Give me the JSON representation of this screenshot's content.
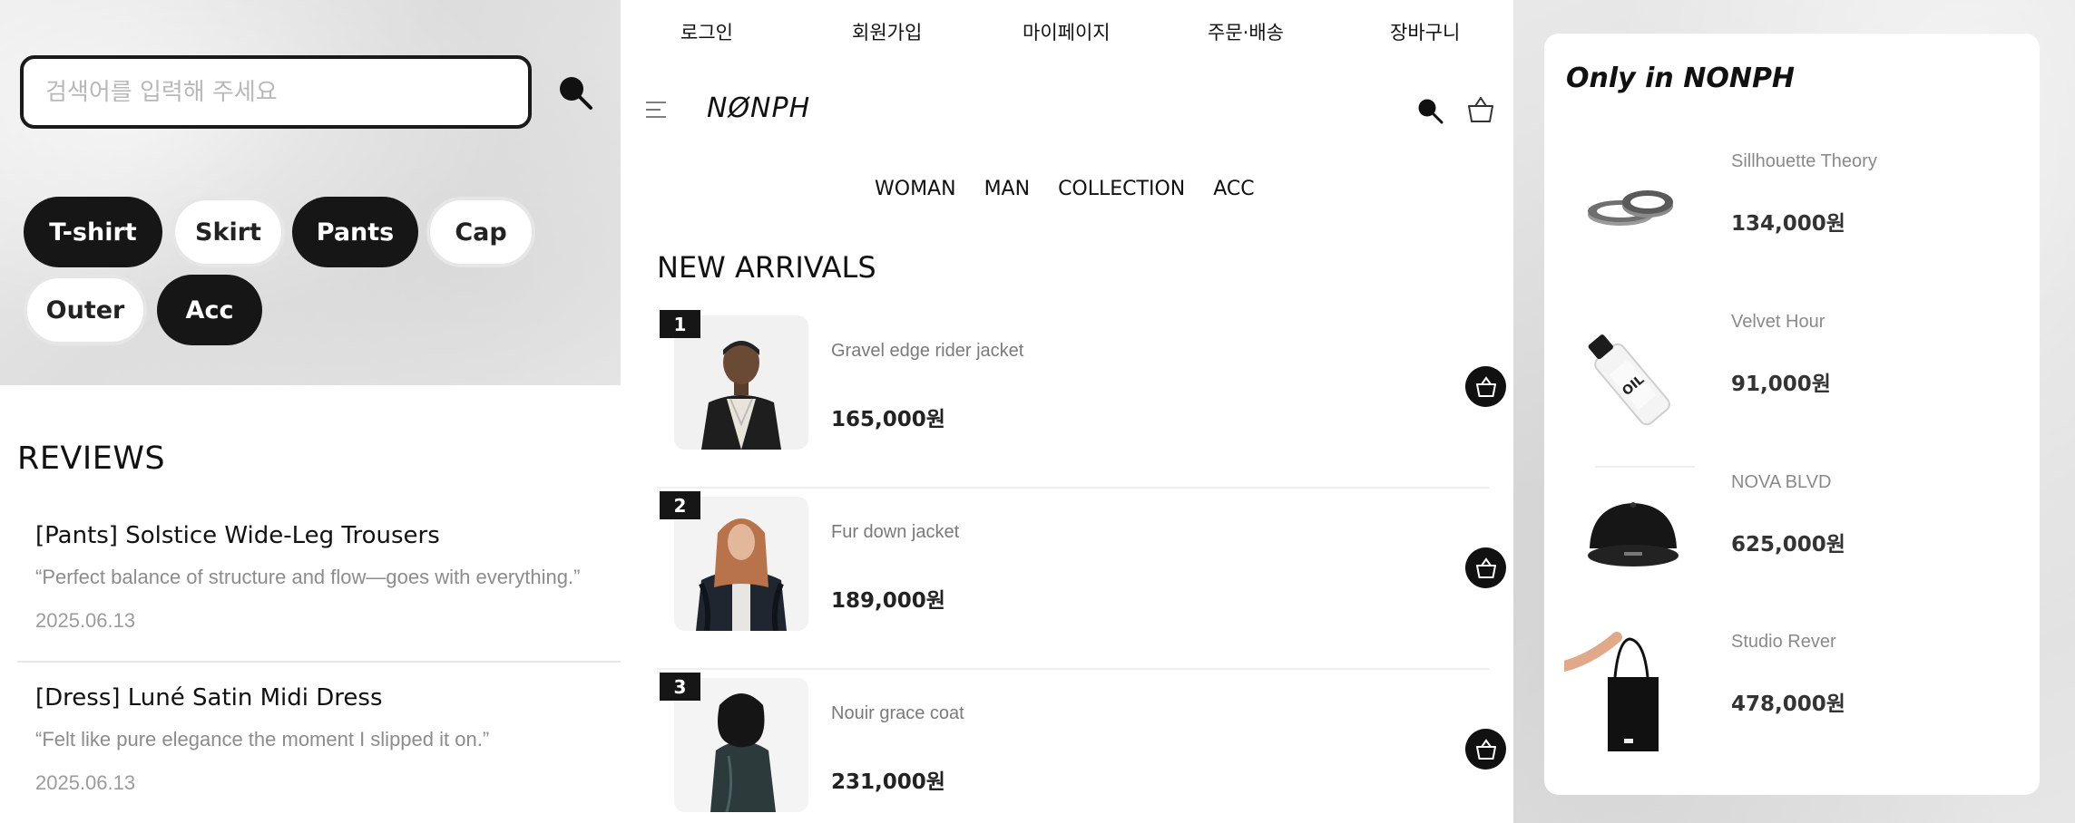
{
  "search": {
    "placeholder": "검색어를 입력해 주세요"
  },
  "categories": [
    "T-shirt",
    "Skirt",
    "Pants",
    "Cap",
    "Outer",
    "Acc"
  ],
  "reviews": {
    "title": "REVIEWS",
    "items": [
      {
        "title": "[Pants] Solstice Wide-Leg Trousers",
        "quote": "“Perfect balance of structure and flow—goes with everything.”",
        "date": "2025.06.13"
      },
      {
        "title": "[Dress] Luné Satin Midi Dress",
        "quote": "“Felt like pure elegance the moment I slipped it on.”",
        "date": "2025.06.13"
      }
    ]
  },
  "topnav": [
    "로그인",
    "회원가입",
    "마이페이지",
    "주문·배송",
    "장바구니"
  ],
  "header": {
    "logo": "NØNPH"
  },
  "catnav": [
    "WOMAN",
    "MAN",
    "COLLECTION",
    "ACC"
  ],
  "new_arrivals": {
    "title": "NEW ARRIVALS",
    "items": [
      {
        "rank": "1",
        "name": "Gravel edge rider jacket",
        "price": "165,000원"
      },
      {
        "rank": "2",
        "name": "Fur down jacket",
        "price": "189,000원"
      },
      {
        "rank": "3",
        "name": "Nouir grace coat",
        "price": "231,000원"
      }
    ]
  },
  "only_in": {
    "title": "Only in NONPH",
    "items": [
      {
        "name": "Sillhouette Theory",
        "price": "134,000원",
        "icon": "rings-icon"
      },
      {
        "name": "Velvet Hour",
        "price": "91,000원",
        "icon": "oil-bottle-icon"
      },
      {
        "name": "NOVA BLVD",
        "price": "625,000원",
        "icon": "cap-icon"
      },
      {
        "name": "Studio Rever",
        "price": "478,000원",
        "icon": "tote-bag-icon"
      }
    ]
  },
  "colors": {
    "accent": "#161616",
    "muted_text": "#8c8c8c",
    "divider": "#e7e7e7"
  }
}
